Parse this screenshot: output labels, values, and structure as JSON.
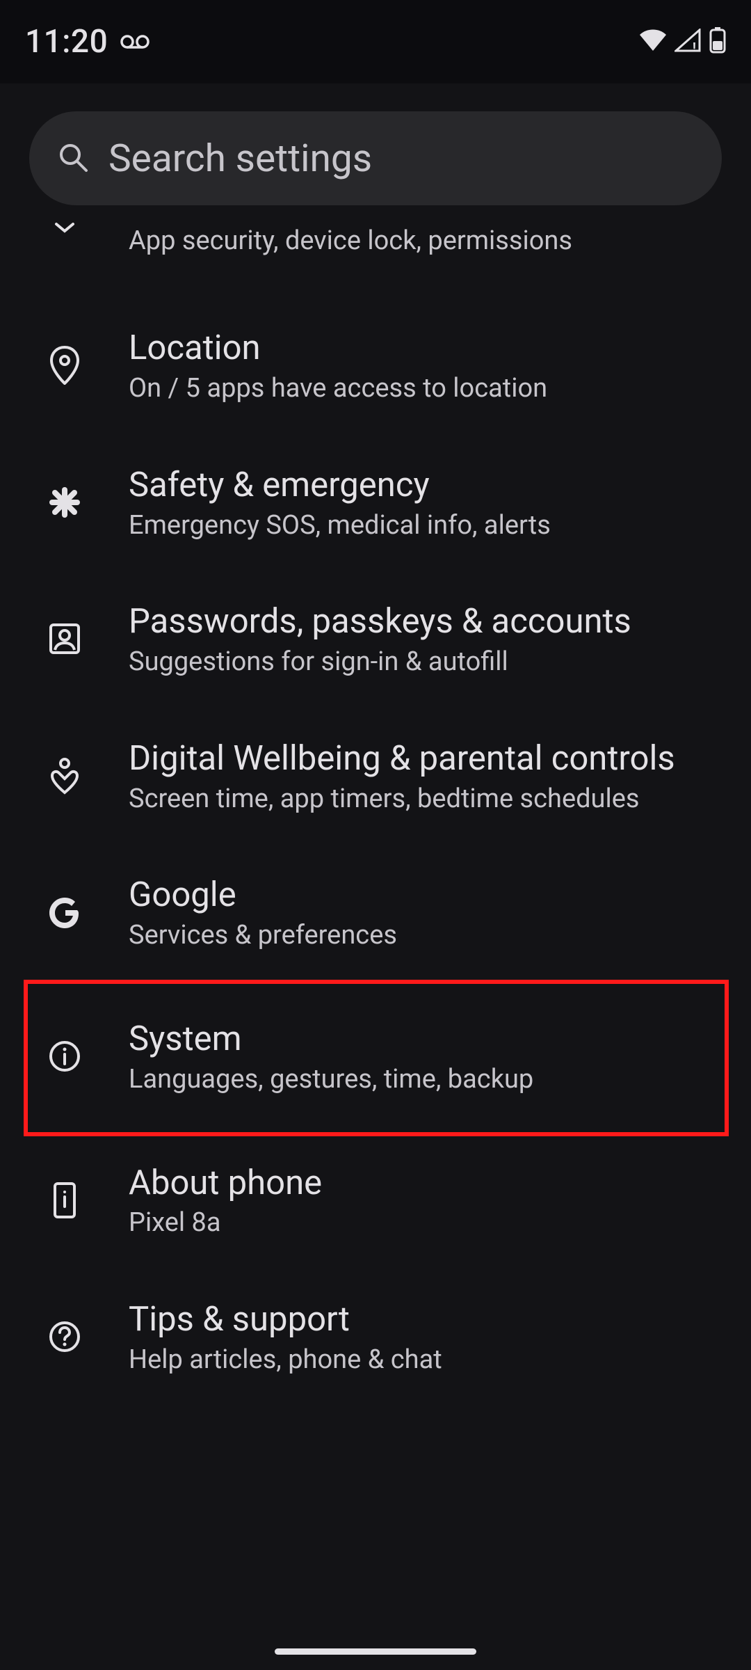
{
  "status": {
    "time": "11:20"
  },
  "search": {
    "placeholder": "Search settings"
  },
  "items": {
    "partial": {
      "subtitle": "App security, device lock, permissions"
    },
    "location": {
      "title": "Location",
      "subtitle": "On / 5 apps have access to location"
    },
    "safety": {
      "title": "Safety & emergency",
      "subtitle": "Emergency SOS, medical info, alerts"
    },
    "passwords": {
      "title": "Passwords, passkeys & accounts",
      "subtitle": "Suggestions for sign-in & autofill"
    },
    "wellbeing": {
      "title": "Digital Wellbeing & parental controls",
      "subtitle": "Screen time, app timers, bedtime schedules"
    },
    "google": {
      "title": "Google",
      "subtitle": "Services & preferences"
    },
    "system": {
      "title": "System",
      "subtitle": "Languages, gestures, time, backup"
    },
    "about": {
      "title": "About phone",
      "subtitle": "Pixel 8a"
    },
    "tips": {
      "title": "Tips & support",
      "subtitle": "Help articles, phone & chat"
    }
  },
  "highlighted": "system"
}
